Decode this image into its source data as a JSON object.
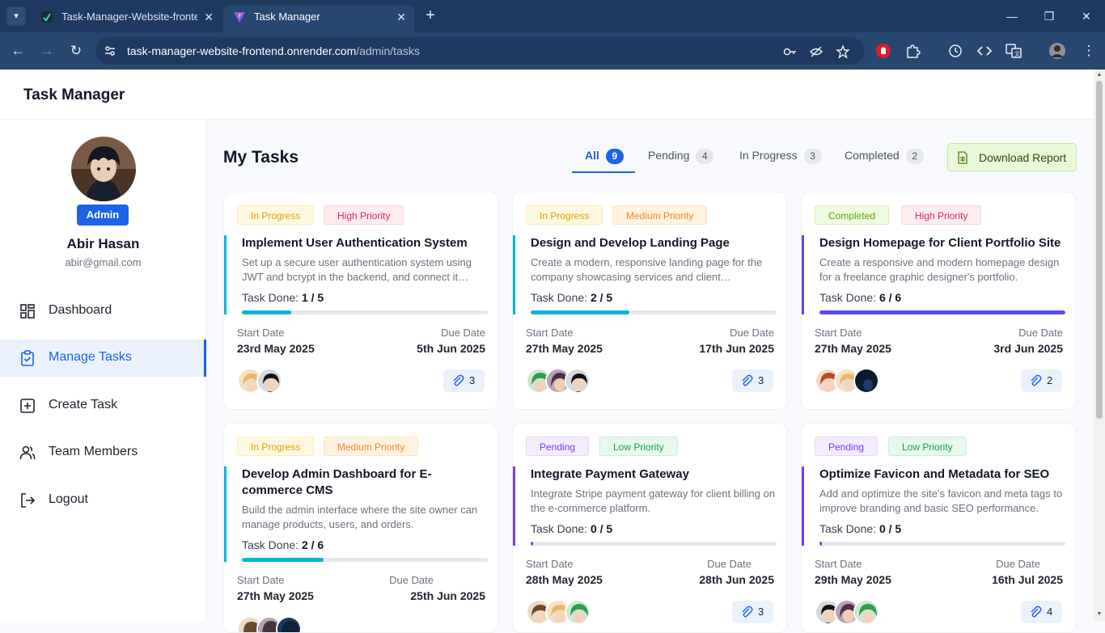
{
  "browser": {
    "tabs": [
      {
        "title": "Task-Manager-Website-fronten"
      },
      {
        "title": "Task Manager"
      }
    ],
    "url_host": "task-manager-website-frontend.onrender.com",
    "url_path": "/admin/tasks"
  },
  "header": {
    "app_title": "Task Manager"
  },
  "sidebar": {
    "role": "Admin",
    "name": "Abir Hasan",
    "email": "abir@gmail.com",
    "items": [
      {
        "label": "Dashboard"
      },
      {
        "label": "Manage Tasks"
      },
      {
        "label": "Create Task"
      },
      {
        "label": "Team Members"
      },
      {
        "label": "Logout"
      }
    ]
  },
  "main": {
    "title": "My Tasks",
    "filters": [
      {
        "label": "All",
        "count": "9"
      },
      {
        "label": "Pending",
        "count": "4"
      },
      {
        "label": "In Progress",
        "count": "3"
      },
      {
        "label": "Completed",
        "count": "2"
      }
    ],
    "download_label": "Download Report",
    "start_label": "Start Date",
    "due_label": "Due Date",
    "task_done_label": "Task Done:",
    "cards": [
      {
        "status": "In Progress",
        "priority": "High Priority",
        "title": "Implement User Authentication System",
        "desc": "Set up a secure user authentication system using JWT and bcrypt in the backend, and connect it…",
        "done": "1 / 5",
        "progress": 0.2,
        "start": "23rd May 2025",
        "due": "5th Jun 2025",
        "attachments": "3"
      },
      {
        "status": "In Progress",
        "priority": "Medium Priority",
        "title": "Design and Develop Landing Page",
        "desc": "Create a modern, responsive landing page for the company showcasing services and client…",
        "done": "2 / 5",
        "progress": 0.4,
        "start": "27th May 2025",
        "due": "17th Jun 2025",
        "attachments": "3"
      },
      {
        "status": "Completed",
        "priority": "High Priority",
        "title": "Design Homepage for Client Portfolio Site",
        "desc": "Create a responsive and modern homepage design for a freelance graphic designer's portfolio.",
        "done": "6 / 6",
        "progress": 1.0,
        "start": "27th May 2025",
        "due": "3rd Jun 2025",
        "attachments": "2"
      },
      {
        "status": "In Progress",
        "priority": "Medium Priority",
        "title": "Develop Admin Dashboard for E-commerce CMS",
        "desc": "Build the admin interface where the site owner can manage products, users, and orders.",
        "done": "2 / 6",
        "progress": 0.333,
        "start": "27th May 2025",
        "due": "25th Jun 2025",
        "attachments": ""
      },
      {
        "status": "Pending",
        "priority": "Low Priority",
        "title": "Integrate Payment Gateway",
        "desc": "Integrate Stripe payment gateway for client billing on the e-commerce platform.",
        "done": "0 / 5",
        "progress": 0.0,
        "start": "28th May 2025",
        "due": "28th Jun 2025",
        "attachments": "3"
      },
      {
        "status": "Pending",
        "priority": "Low Priority",
        "title": "Optimize Favicon and Metadata for SEO",
        "desc": "Add and optimize the site's favicon and meta tags to improve branding and basic SEO performance.",
        "done": "0 / 5",
        "progress": 0.0,
        "start": "29th May 2025",
        "due": "16th Jul 2025",
        "attachments": "4"
      }
    ]
  },
  "colors": {
    "accent": "#1e62e6",
    "in_progress": "#06b6d4",
    "completed": "#5b4ee8",
    "pending": "#7c3aed"
  }
}
